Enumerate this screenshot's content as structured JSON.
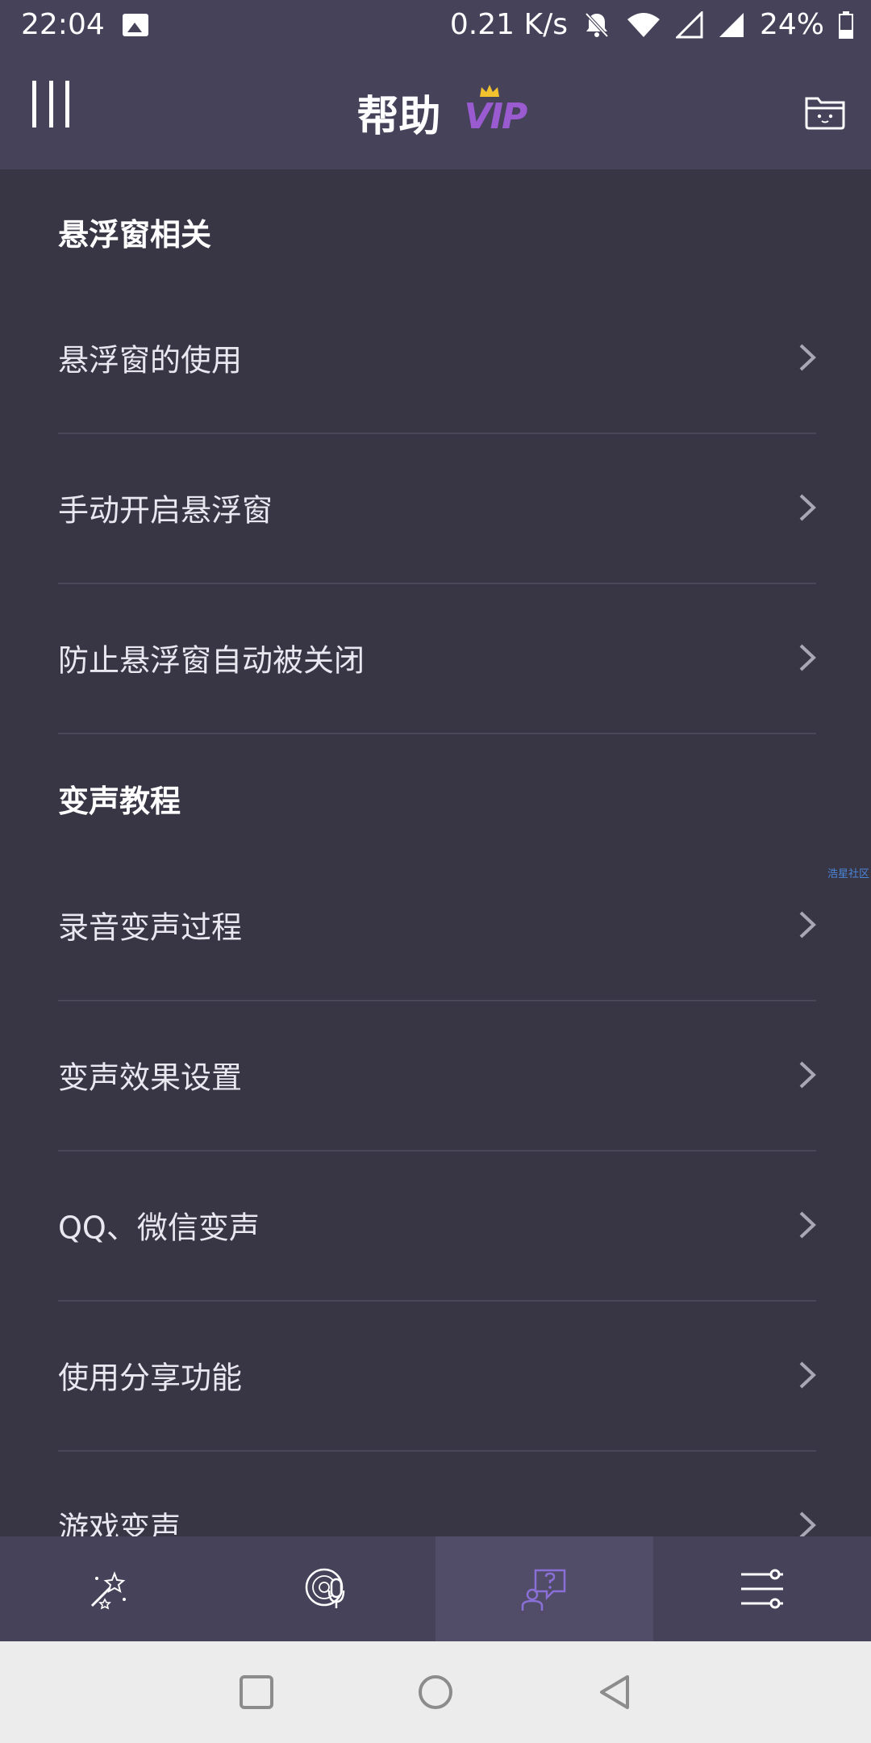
{
  "status": {
    "time": "22:04",
    "net_speed": "0.21 K/s",
    "battery": "24%"
  },
  "header": {
    "title": "帮助",
    "vip_badge": "VIP"
  },
  "sections": [
    {
      "title": "悬浮窗相关",
      "items": [
        "悬浮窗的使用",
        "手动开启悬浮窗",
        "防止悬浮窗自动被关闭"
      ]
    },
    {
      "title": "变声教程",
      "items": [
        "录音变声过程",
        "变声效果设置",
        "QQ、微信变声",
        "使用分享功能",
        "游戏变声"
      ]
    }
  ],
  "watermark": "浩星社区",
  "bottom_nav": {
    "active_index": 2,
    "items": [
      {
        "icon": "magic-wand-icon"
      },
      {
        "icon": "voice-record-icon"
      },
      {
        "icon": "help-chat-icon"
      },
      {
        "icon": "settings-sliders-icon"
      }
    ]
  },
  "colors": {
    "background": "#383545",
    "bar": "#45425a",
    "accent": "#9a5bd0",
    "active_nav": "#514d68"
  }
}
